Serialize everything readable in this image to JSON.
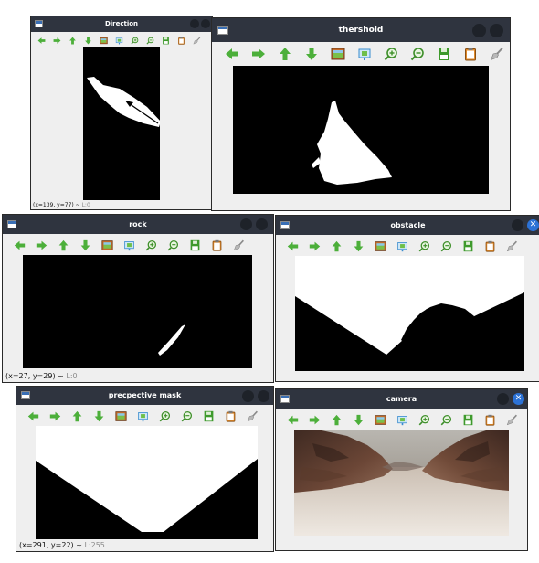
{
  "windows": {
    "direction": {
      "title": "Direction",
      "status": "(x=139, y=77) ~ ",
      "status_gray": "L:0"
    },
    "threshold": {
      "title": "thershold",
      "status": "",
      "status_gray": ""
    },
    "rock": {
      "title": "rock",
      "status": "(x=27, y=29) ~ ",
      "status_gray": "L:0"
    },
    "obstacle": {
      "title": "obstacle",
      "status": "",
      "status_gray": ""
    },
    "perspective_mask": {
      "title": "precpective mask",
      "status": "(x=291, y=22) ~ ",
      "status_gray": "L:255"
    },
    "camera": {
      "title": "camera",
      "status": "",
      "status_gray": ""
    }
  },
  "toolbar_buttons": [
    "arrow-left-icon",
    "arrow-right-icon",
    "arrow-up-icon",
    "arrow-down-icon",
    "image-icon",
    "fit-view-icon",
    "zoom-in-icon",
    "zoom-out-icon",
    "save-icon",
    "clipboard-icon",
    "brush-icon"
  ],
  "colors": {
    "titlebar": "#2f343f",
    "window_bg": "#efefef",
    "arrow_green": "#4caf3a",
    "close_active": "#2c72d6"
  }
}
